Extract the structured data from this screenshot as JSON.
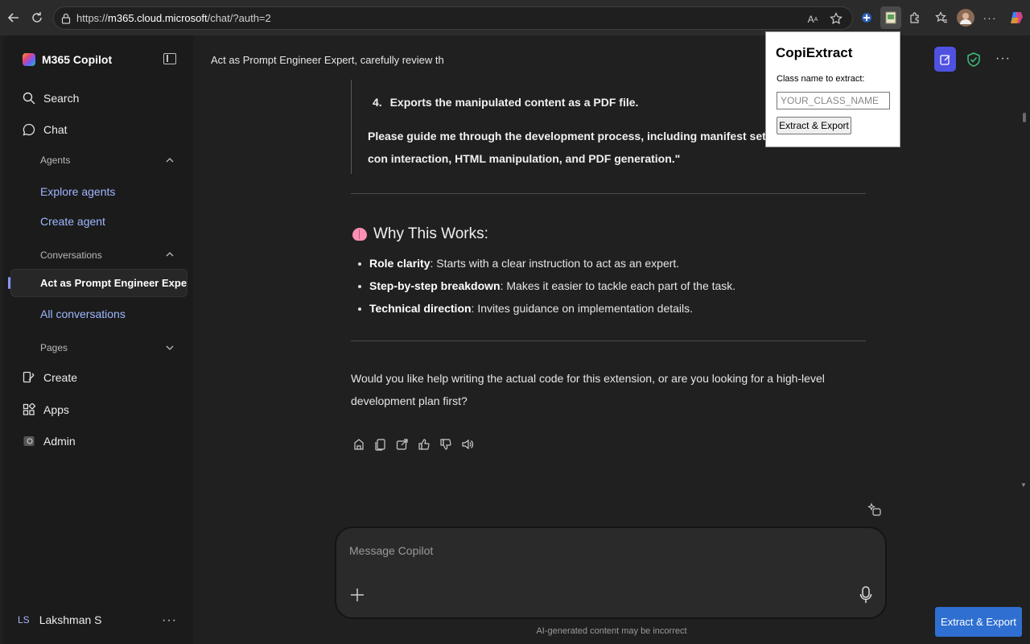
{
  "browser": {
    "url_prefix": "https://",
    "url_host": "m365.cloud.microsoft",
    "url_path": "/chat/?auth=2"
  },
  "sidebar": {
    "brand": "M365 Copilot",
    "search": "Search",
    "chat": "Chat",
    "agents_label": "Agents",
    "explore_agents": "Explore agents",
    "create_agent": "Create agent",
    "conversations_label": "Conversations",
    "active_conversation": "Act as Prompt Engineer Exper...",
    "all_conversations": "All conversations",
    "pages_label": "Pages",
    "create": "Create",
    "apps": "Apps",
    "admin": "Admin",
    "user_initials": "LS",
    "user_name": "Lakshman S",
    "user_more": "···"
  },
  "main": {
    "chat_title": "Act as Prompt Engineer Expert, carefully review th",
    "more": "···",
    "list_item_number": "4.",
    "list_item_text": "Exports the manipulated content as a PDF file.",
    "quote_paragraph": "Please guide me through the development process, including manifest setup, con interaction, HTML manipulation, and PDF generation.\"",
    "why_title": "Why This Works:",
    "bullets": [
      {
        "term": "Role clarity",
        "text": ": Starts with a clear instruction to act as an expert."
      },
      {
        "term": "Step-by-step breakdown",
        "text": ": Makes it easier to tackle each part of the task."
      },
      {
        "term": "Technical direction",
        "text": ": Invites guidance on implementation details."
      }
    ],
    "closing": "Would you like help writing the actual code for this extension, or are you looking for a high-level development plan first?",
    "composer_placeholder": "Message Copilot",
    "disclaimer": "AI-generated content may be incorrect",
    "floating_button": "Extract & Export"
  },
  "popup": {
    "title": "CopiExtract",
    "label": "Class name to extract:",
    "input_placeholder": "YOUR_CLASS_NAME",
    "button": "Extract & Export"
  },
  "colors": {
    "accent": "#4f52e0",
    "link": "#9fb7ff",
    "floating_button": "#2f6fd1"
  }
}
